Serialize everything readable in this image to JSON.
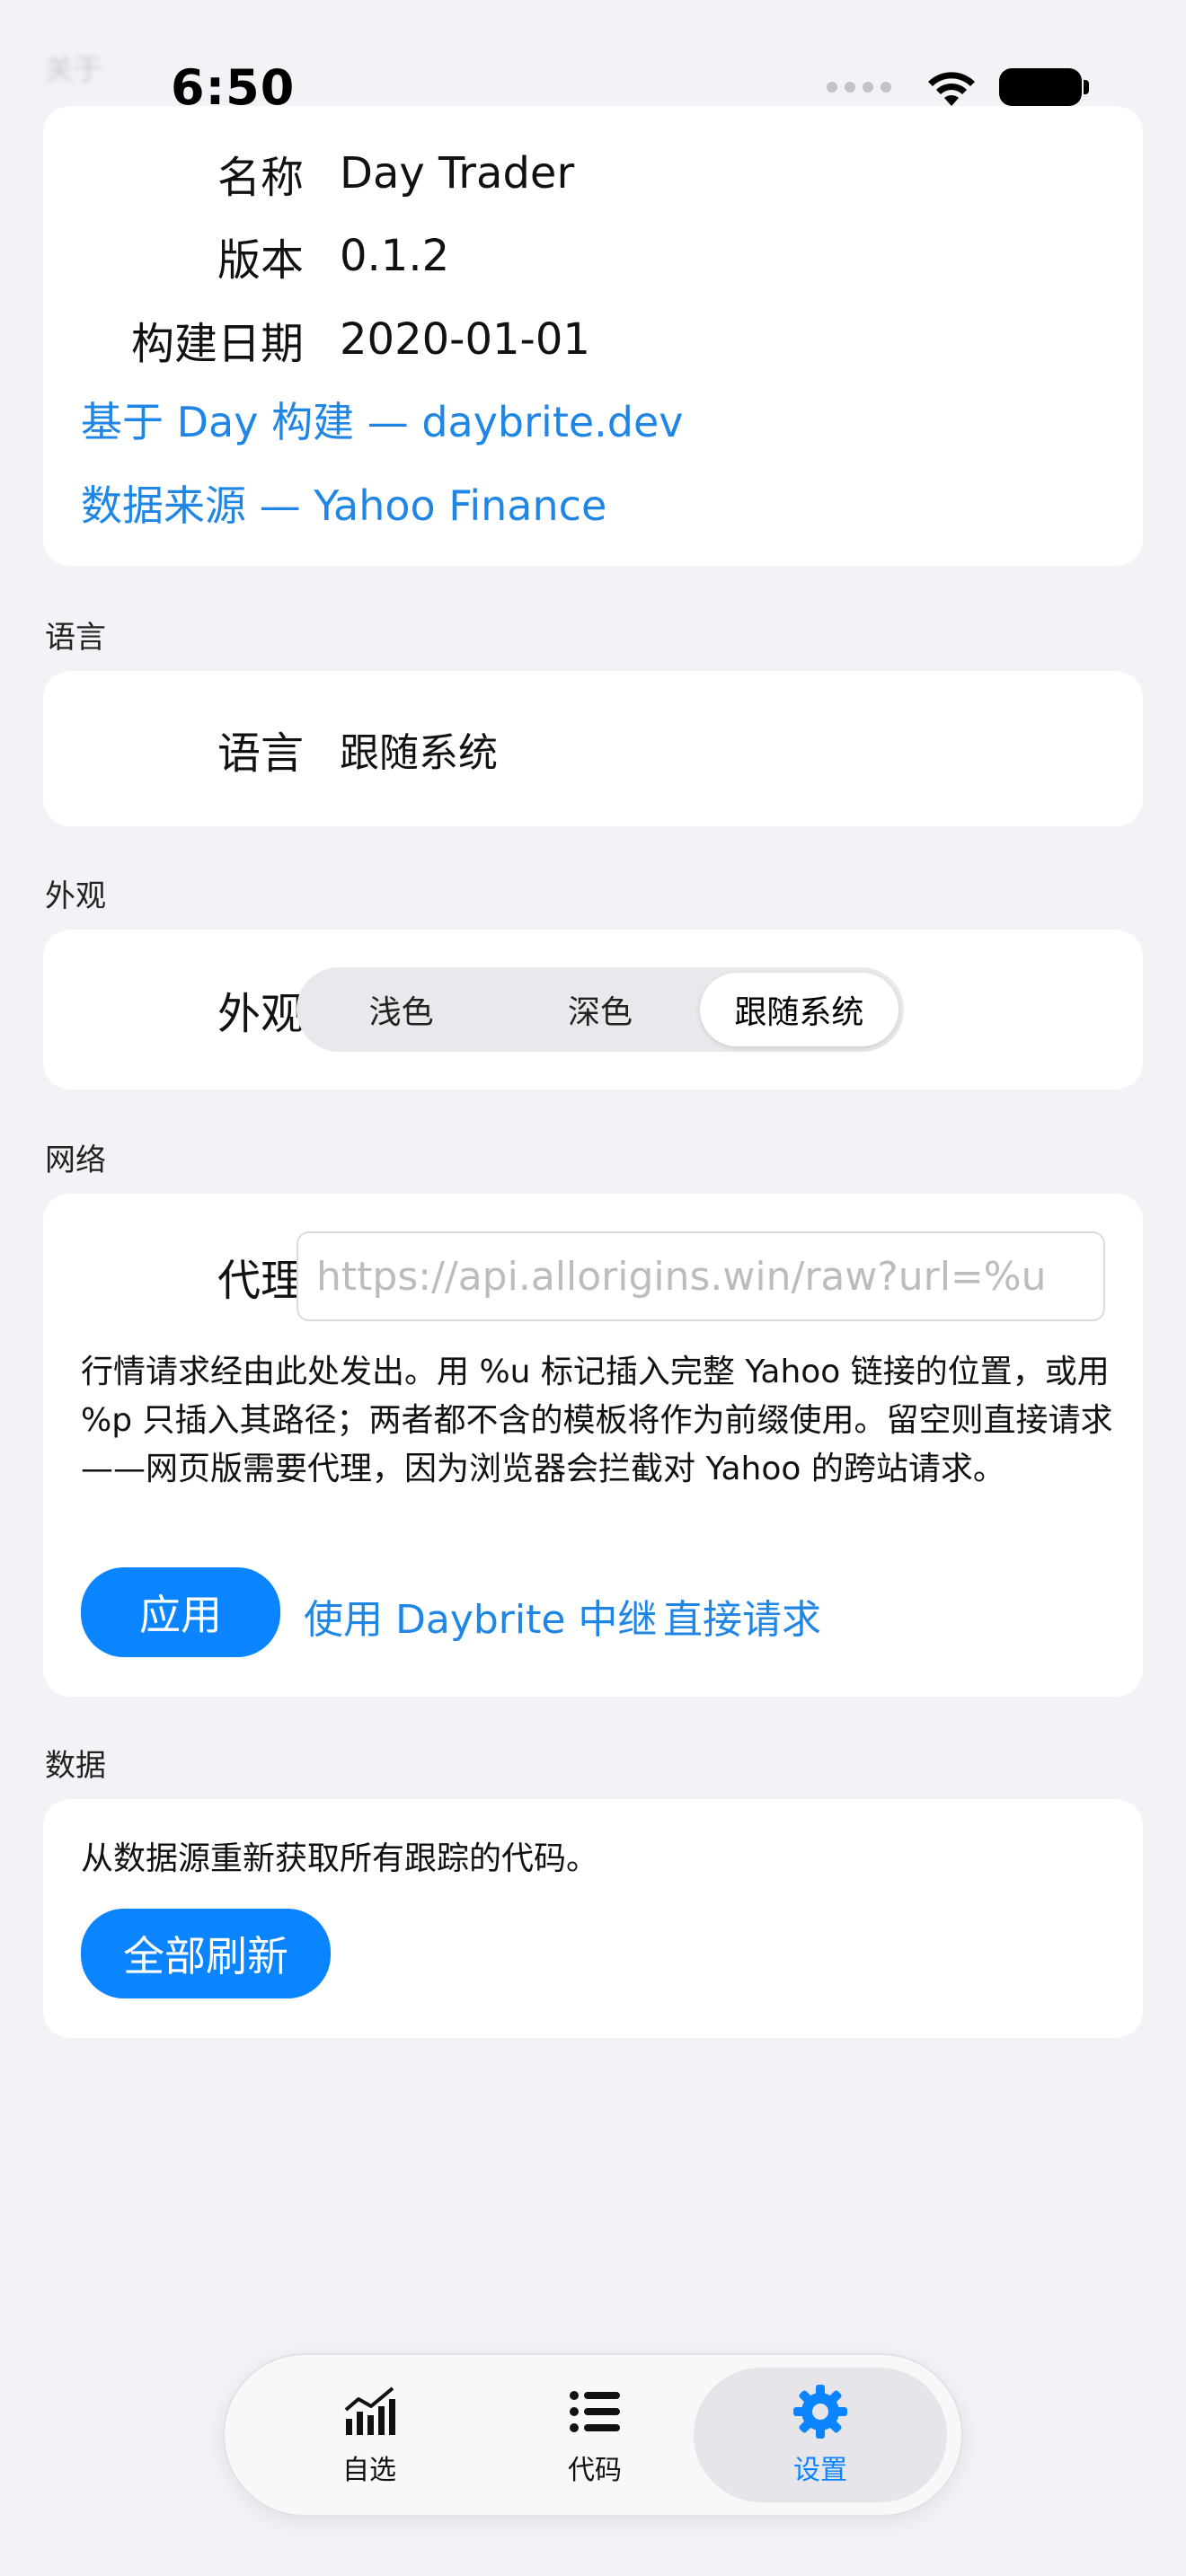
{
  "ghost_header": "关于",
  "status_bar": {
    "time": "6:50"
  },
  "about": {
    "rows": [
      {
        "label": "名称",
        "value": "Day Trader"
      },
      {
        "label": "版本",
        "value": "0.1.2"
      },
      {
        "label": "构建日期",
        "value": "2020-01-01"
      }
    ],
    "built_with_link": "基于 Day 构建 — daybrite.dev",
    "data_source_link": "数据来源 — Yahoo Finance"
  },
  "language": {
    "section_title": "语言",
    "label": "语言",
    "value": "跟随系统"
  },
  "appearance": {
    "section_title": "外观",
    "label": "外观",
    "options": [
      "浅色",
      "深色",
      "跟随系统"
    ],
    "selected_index": 2
  },
  "network": {
    "section_title": "网络",
    "proxy_label": "代理",
    "proxy_value": "",
    "proxy_placeholder": "https://api.allorigins.win/raw?url=%u",
    "description": "行情请求经由此处发出。用 %u 标记插入完整 Yahoo 链接的位置，或用 %p 只插入其路径；两者都不含的模板将作为前缀使用。留空则直接请求——网页版需要代理，因为浏览器会拦截对 Yahoo 的跨站请求。",
    "apply_button": "应用",
    "use_relay_button": "使用 Daybrite 中继",
    "direct_button": "直接请求"
  },
  "data_section": {
    "section_title": "数据",
    "description": "从数据源重新获取所有跟踪的代码。",
    "refresh_button": "全部刷新"
  },
  "tabbar": {
    "tabs": [
      {
        "label": "自选",
        "icon": "chart-icon"
      },
      {
        "label": "代码",
        "icon": "list-icon"
      },
      {
        "label": "设置",
        "icon": "gear-icon"
      }
    ],
    "active_index": 2
  },
  "colors": {
    "accent": "#0a84ff",
    "link": "#1f86e6",
    "background": "#f2f2f7",
    "card": "#ffffff"
  }
}
